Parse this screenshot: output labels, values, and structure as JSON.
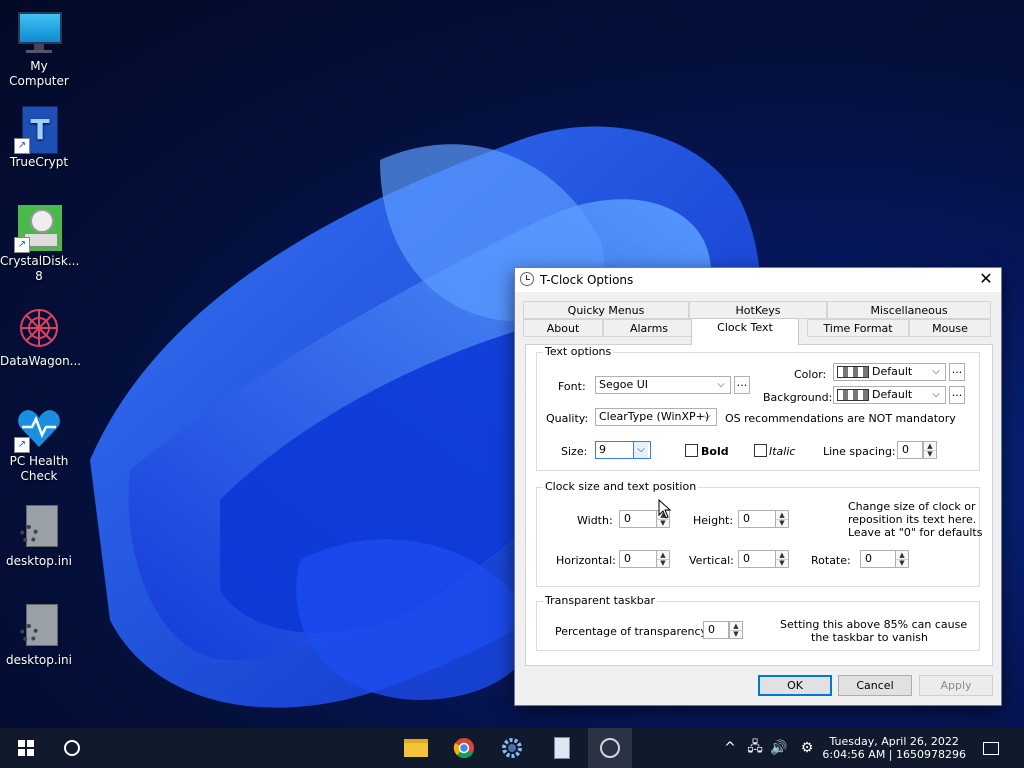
{
  "desktop": {
    "icons": [
      {
        "label": "My Computer",
        "icon": "monitor-icon"
      },
      {
        "label": "TrueCrypt",
        "icon": "truecrypt-icon"
      },
      {
        "label": "CrystalDisk... 8",
        "icon": "crystaldisk-icon"
      },
      {
        "label": "DataWagon...",
        "icon": "datawagon-icon"
      },
      {
        "label": "PC Health Check",
        "icon": "health-heart-icon"
      },
      {
        "label": "desktop.ini",
        "icon": "gear-file-icon"
      },
      {
        "label": "desktop.ini",
        "icon": "gear-file-icon"
      }
    ]
  },
  "dialog": {
    "title": "T-Clock Options",
    "tabs_row1": [
      "Quicky Menus",
      "HotKeys",
      "Miscellaneous"
    ],
    "tabs_row2": [
      "About",
      "Alarms",
      "Clock Text",
      "Time Format",
      "Mouse"
    ],
    "selected_tab": "Clock Text",
    "text_options": {
      "legend": "Text options",
      "font_label": "Font:",
      "font_value": "Segoe UI",
      "browse": "...",
      "color_label": "Color:",
      "color_value": "Default",
      "background_label": "Background:",
      "background_value": "Default",
      "quality_label": "Quality:",
      "quality_value": "ClearType (WinXP+)",
      "quality_note": "OS recommendations are NOT mandatory",
      "size_label": "Size:",
      "size_value": "9",
      "bold_label": "Bold",
      "italic_label": "Italic",
      "line_spacing_label": "Line spacing:",
      "line_spacing_value": "0"
    },
    "clock_size": {
      "legend": "Clock size and text position",
      "width_label": "Width:",
      "width_value": "0",
      "height_label": "Height:",
      "height_value": "0",
      "help_1": "Change size of clock or",
      "help_2": "reposition its text here.",
      "help_3": "Leave at \"0\" for defaults",
      "horizontal_label": "Horizontal:",
      "horizontal_value": "0",
      "vertical_label": "Vertical:",
      "vertical_value": "0",
      "rotate_label": "Rotate:",
      "rotate_value": "0"
    },
    "transparent": {
      "legend": "Transparent taskbar",
      "percent_label": "Percentage of transparency:",
      "percent_value": "0",
      "note_1": "Setting this above 85% can cause",
      "note_2": "the taskbar to vanish"
    },
    "buttons": {
      "ok": "OK",
      "cancel": "Cancel",
      "apply": "Apply"
    }
  },
  "taskbar": {
    "clock_line1": "Tuesday, April 26, 2022",
    "clock_line2": "6:04:56 AM | 1650978296"
  },
  "colors": {
    "accent": "#0078d7",
    "taskbar": "#101a2c"
  }
}
